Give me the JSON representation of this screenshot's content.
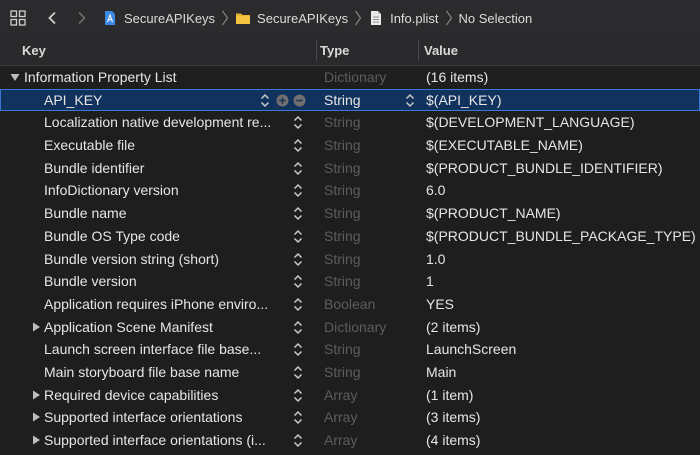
{
  "breadcrumbs": [
    {
      "label": "SecureAPIKeys",
      "icon": "project-file-icon"
    },
    {
      "label": "SecureAPIKeys",
      "icon": "folder-icon"
    },
    {
      "label": "Info.plist",
      "icon": "plist-file-icon"
    },
    {
      "label": "No Selection",
      "icon": ""
    }
  ],
  "header": {
    "key": "Key",
    "type": "Type",
    "value": "Value"
  },
  "rows": [
    {
      "key": "Information Property List",
      "type": "Dictionary",
      "value": "(16 items)",
      "disclosure": "expanded",
      "root": true
    },
    {
      "key": "API_KEY",
      "type": "String",
      "value": "$(API_KEY)",
      "selected": true
    },
    {
      "key": "Localization native development re...",
      "type": "String",
      "value": "$(DEVELOPMENT_LANGUAGE)"
    },
    {
      "key": "Executable file",
      "type": "String",
      "value": "$(EXECUTABLE_NAME)"
    },
    {
      "key": "Bundle identifier",
      "type": "String",
      "value": "$(PRODUCT_BUNDLE_IDENTIFIER)"
    },
    {
      "key": "InfoDictionary version",
      "type": "String",
      "value": "6.0"
    },
    {
      "key": "Bundle name",
      "type": "String",
      "value": "$(PRODUCT_NAME)"
    },
    {
      "key": "Bundle OS Type code",
      "type": "String",
      "value": "$(PRODUCT_BUNDLE_PACKAGE_TYPE)"
    },
    {
      "key": "Bundle version string (short)",
      "type": "String",
      "value": "1.0"
    },
    {
      "key": "Bundle version",
      "type": "String",
      "value": "1"
    },
    {
      "key": "Application requires iPhone enviro...",
      "type": "Boolean",
      "value": "YES"
    },
    {
      "key": "Application Scene Manifest",
      "type": "Dictionary",
      "value": "(2 items)",
      "disclosure": "collapsed"
    },
    {
      "key": "Launch screen interface file base...",
      "type": "String",
      "value": "LaunchScreen"
    },
    {
      "key": "Main storyboard file base name",
      "type": "String",
      "value": "Main"
    },
    {
      "key": "Required device capabilities",
      "type": "Array",
      "value": "(1 item)",
      "disclosure": "collapsed"
    },
    {
      "key": "Supported interface orientations",
      "type": "Array",
      "value": "(3 items)",
      "disclosure": "collapsed"
    },
    {
      "key": "Supported interface orientations (i...",
      "type": "Array",
      "value": "(4 items)",
      "disclosure": "collapsed"
    }
  ],
  "colors": {
    "selection": "#12325e",
    "selection_border": "#3b78d4",
    "muted_type": "#5d5d60",
    "background": "#1e1e1e"
  }
}
